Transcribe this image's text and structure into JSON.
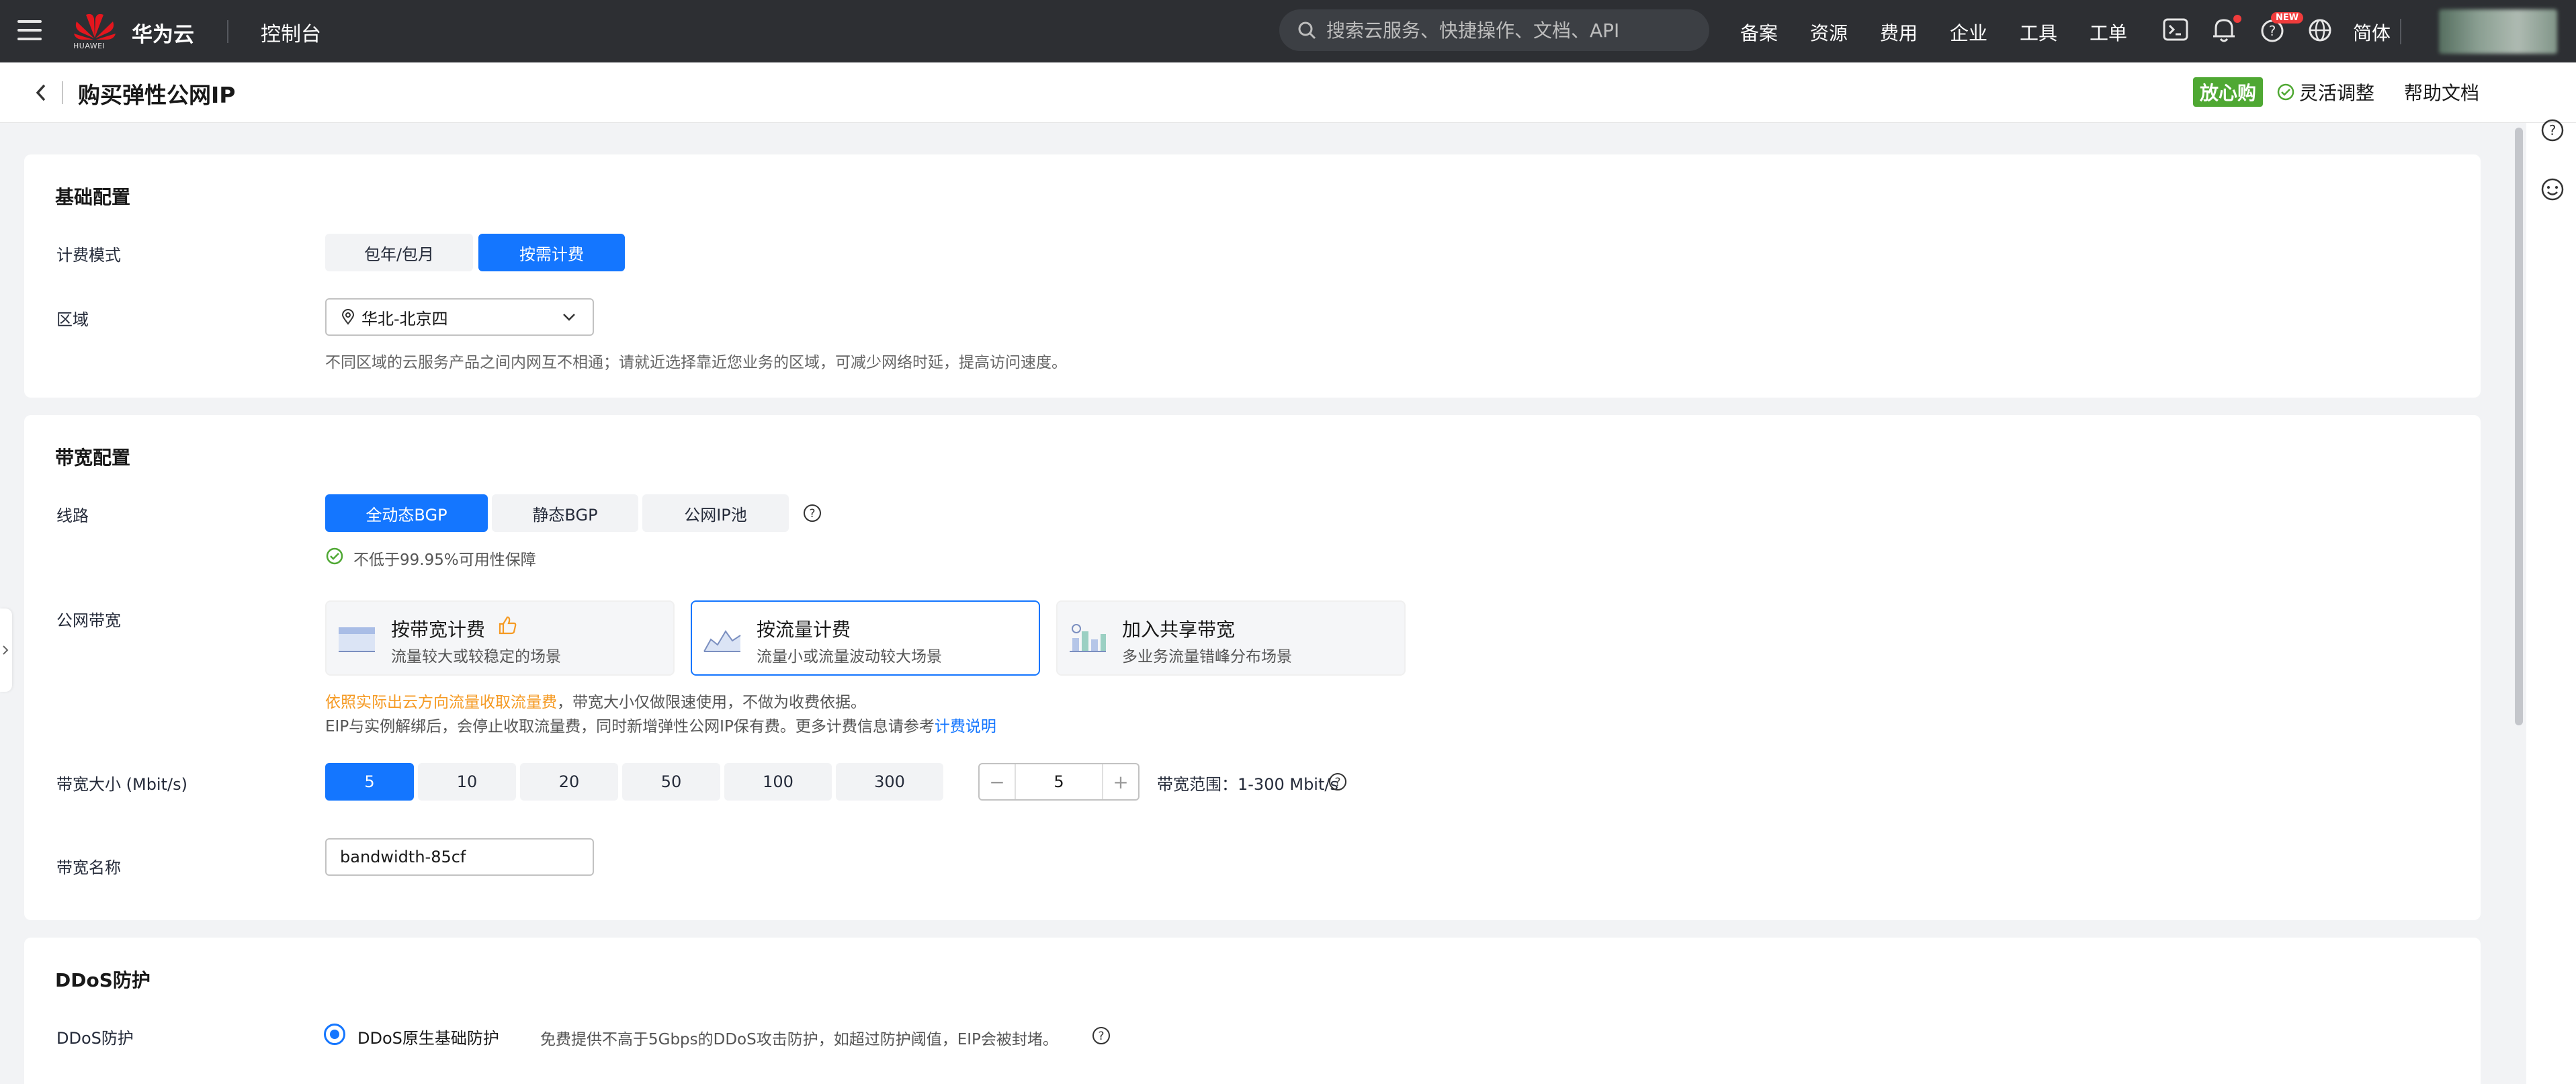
{
  "topbar": {
    "logo_small_text": "HUAWEI",
    "brand": "华为云",
    "console": "控制台",
    "search_placeholder": "搜索云服务、快捷操作、文档、API",
    "links": [
      "备案",
      "资源",
      "费用",
      "企业",
      "工具",
      "工单"
    ],
    "new_badge": "NEW",
    "lang": "简体"
  },
  "pagehead": {
    "title": "购买弹性公网IP",
    "badge": "放心购",
    "flex_adjust": "灵活调整",
    "help_doc": "帮助文档"
  },
  "basic": {
    "title": "基础配置",
    "billing_label": "计费模式",
    "billing_options": [
      "包年/包月",
      "按需计费"
    ],
    "billing_selected": "按需计费",
    "region_label": "区域",
    "region_value": "华北-北京四",
    "region_hint": "不同区域的云服务产品之间内网互不相通；请就近选择靠近您业务的区域，可减少网络时延，提高访问速度。"
  },
  "bandwidth": {
    "title": "带宽配置",
    "line_label": "线路",
    "line_options": [
      "全动态BGP",
      "静态BGP",
      "公网IP池"
    ],
    "line_selected": "全动态BGP",
    "availability": "不低于99.95%可用性保障",
    "public_bw_label": "公网带宽",
    "bw_types": [
      {
        "title": "按带宽计费",
        "sub": "流量较大或较稳定的场景"
      },
      {
        "title": "按流量计费",
        "sub": "流量小或流量波动较大场景"
      },
      {
        "title": "加入共享带宽",
        "sub": "多业务流量错峰分布场景"
      }
    ],
    "bw_type_selected": "按流量计费",
    "note_orange": "依照实际出云方向流量收取流量费",
    "note_rest": "，带宽大小仅做限速使用，不做为收费依据。",
    "note2": "EIP与实例解绑后，会停止收取流量费，同时新增弹性公网IP保有费。更多计费信息请参考",
    "note2_link": "计费说明",
    "size_label": "带宽大小 (Mbit/s)",
    "size_options": [
      "5",
      "10",
      "20",
      "50",
      "100",
      "300"
    ],
    "size_selected": "5",
    "stepper_minus": "−",
    "stepper_value": "5",
    "stepper_plus": "+",
    "range_text": "带宽范围：1-300 Mbit/s",
    "name_label": "带宽名称",
    "name_value": "bandwidth-85cf"
  },
  "ddos": {
    "title": "DDoS防护",
    "label": "DDoS防护",
    "option": "DDoS原生基础防护",
    "hint": "免费提供不高于5Gbps的DDoS攻击防护，如超过防护阈值，EIP会被封堵。"
  },
  "colors": {
    "primary": "#1476ff",
    "topbar": "#2d2f33",
    "green": "#4fa833",
    "orange": "#f59a23"
  }
}
